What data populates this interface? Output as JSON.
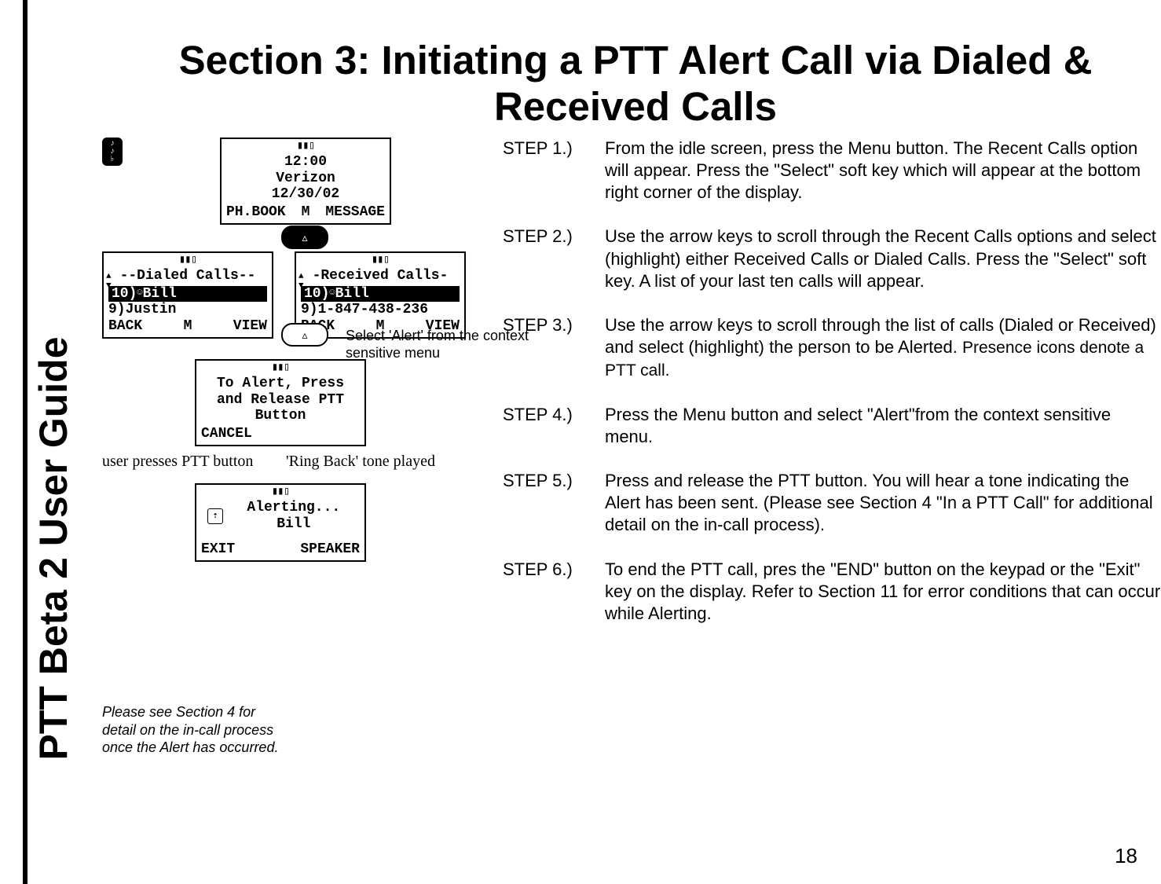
{
  "sidebar": {
    "title": "PTT Beta 2 User Guide"
  },
  "page": {
    "title": "Section 3: Initiating a PTT Alert Call via Dialed & Received Calls",
    "number": "18"
  },
  "phones": {
    "idle": {
      "time": "12:00",
      "carrier": "Verizon",
      "date": "12/30/02",
      "soft_left": "PH.BOOK",
      "soft_mid": "M",
      "soft_right": "MESSAGE"
    },
    "dialed": {
      "header": "--Dialed Calls--",
      "row_hl": "10)  Bill",
      "row2": "9)Justin",
      "soft_left": "BACK",
      "soft_mid": "M",
      "soft_right": "VIEW"
    },
    "received": {
      "header": "-Received Calls-",
      "row_hl": "10)  Bill",
      "row2": "9)1-847-438-236",
      "soft_left": "BACK",
      "soft_mid": "M",
      "soft_right": "VIEW"
    },
    "alert_prompt": {
      "line1": "To Alert, Press",
      "line2": "and Release PTT",
      "line3": "Button",
      "soft_left": "CANCEL"
    },
    "alerting": {
      "line1": "Alerting...",
      "line2": "Bill",
      "soft_left": "EXIT",
      "soft_right": "SPEAKER"
    }
  },
  "notes": {
    "context_menu": "Select 'Alert' from the context sensitive menu",
    "user_press": "user presses PTT button",
    "ring_back": "'Ring Back' tone played",
    "footnote": "Please see Section 4 for detail on the in-call process once the Alert has occurred."
  },
  "steps": [
    {
      "label": "STEP 1.)",
      "text": "From the idle screen, press the Menu button. The Recent Calls option will appear.  Press the \"Select\" soft key which will appear at the bottom right corner of the display."
    },
    {
      "label": "STEP 2.)",
      "text": "Use the arrow keys to scroll through the Recent Calls options and select (highlight) either Received Calls or Dialed Calls. Press the \"Select\" soft key.  A list of your last ten calls will appear."
    },
    {
      "label": "STEP 3.)",
      "text": "Use the arrow keys to scroll through the list of calls (Dialed or Received) and select (highlight) the person to be Alerted.",
      "extra": "Presence icons denote a PTT call."
    },
    {
      "label": "STEP 4.)",
      "text": "Press the Menu button and select \"Alert\"from the context sensitive menu."
    },
    {
      "label": "STEP 5.)",
      "text": "Press and release the PTT button.  You will hear a tone indicating the Alert has been sent.  (Please see Section 4 \"In a PTT Call\" for additional detail on the in-call process)."
    },
    {
      "label": "STEP 6.)",
      "text": "To end the PTT call, pres the \"END\" button on the keypad or the \"Exit\" key on the display. Refer to Section 11 for error conditions that can occur while Alerting."
    }
  ]
}
